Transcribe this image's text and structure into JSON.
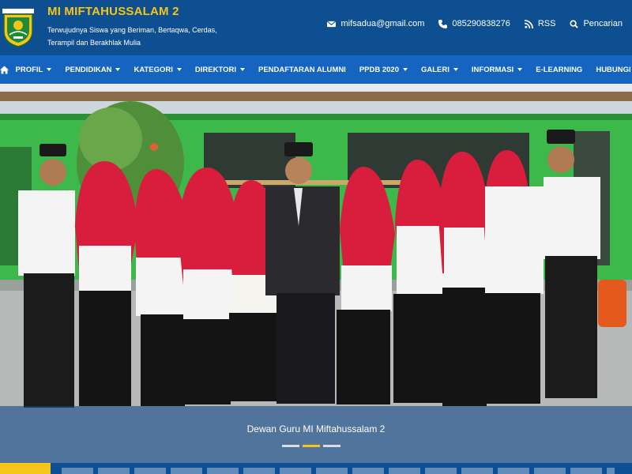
{
  "header": {
    "site_title": "MI MIFTAHUSSALAM 2",
    "tagline": "Terwujudnya Siswa yang Beriman, Bertaqwa, Cerdas, Terampil dan Berakhlak Mulia",
    "email": "mifsadua@gmail.com",
    "phone": "085290838276",
    "rss": "RSS",
    "search": "Pencarian",
    "icons": {
      "email": "envelope-icon",
      "phone": "phone-icon",
      "rss": "rss-icon",
      "search": "search-icon"
    }
  },
  "nav": {
    "home_icon": "home-icon",
    "items": [
      {
        "label": "PROFIL",
        "dropdown": true
      },
      {
        "label": "PENDIDIKAN",
        "dropdown": true
      },
      {
        "label": "KATEGORI",
        "dropdown": true
      },
      {
        "label": "DIREKTORI",
        "dropdown": true
      },
      {
        "label": "PENDAFTARAN ALUMNI",
        "dropdown": false
      },
      {
        "label": "PPDB 2020",
        "dropdown": true
      },
      {
        "label": "GALERI",
        "dropdown": true
      },
      {
        "label": "INFORMASI",
        "dropdown": true
      },
      {
        "label": "E-LEARNING",
        "dropdown": false
      },
      {
        "label": "HUBUNGI KAMI",
        "dropdown": false
      }
    ]
  },
  "slider": {
    "caption": "Dewan Guru MI Miftahussalam 2",
    "slides": 3,
    "active_slide": 2
  },
  "colors": {
    "header_bg": "#0e4f92",
    "nav_bg": "#1565c0",
    "accent": "#f5c518"
  }
}
